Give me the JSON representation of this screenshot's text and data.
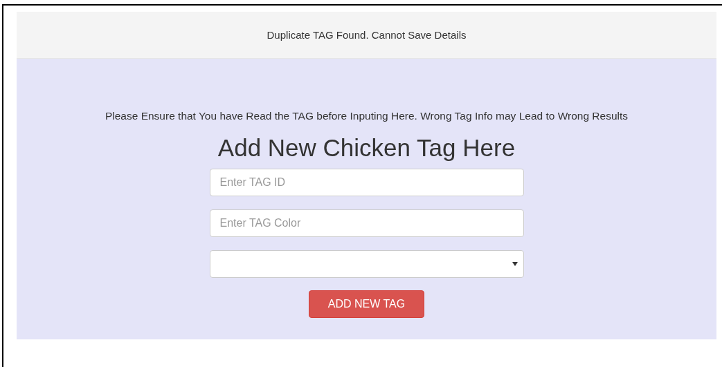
{
  "alert": {
    "message": "Duplicate TAG Found. Cannot Save Details"
  },
  "notice": "Please Ensure that You have Read the TAG before Inputing Here. Wrong Tag Info may Lead to Wrong Results",
  "form": {
    "title": "Add New Chicken Tag Here",
    "fields": [
      {
        "kind": "text",
        "placeholder": "Enter TAG ID"
      },
      {
        "kind": "text",
        "placeholder": "Enter TAG Color"
      },
      {
        "kind": "select"
      }
    ],
    "submit": "ADD NEW TAG"
  }
}
